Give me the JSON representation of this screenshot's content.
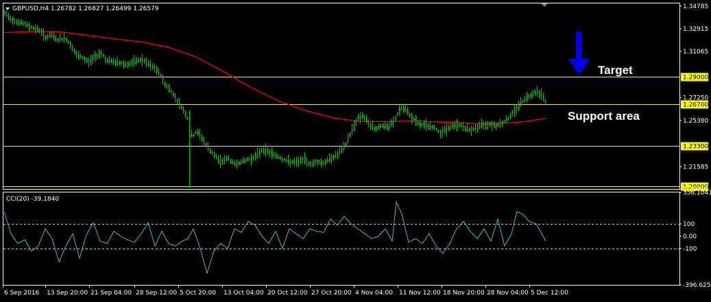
{
  "header": {
    "symbol_line": "GBPUSD,H4  1.26782 1.26827 1.26499 1.26579",
    "menu_icon": "triangle-down-icon"
  },
  "annotations": {
    "target_label": "Target",
    "support_label": "Support area",
    "arrow_icon": "arrow-down-icon",
    "arrow_color": "#0000ff"
  },
  "colors": {
    "background": "#000000",
    "candles": "#00c800",
    "moving_average": "#ff0000",
    "levels": "#e6e680",
    "level_badge": "#ffff00",
    "cci": "#34c2c2",
    "axis": "#ffffff"
  },
  "chart_data": [
    {
      "type": "line",
      "title": "GBPUSD,H4",
      "ylim": [
        1.1975,
        1.35
      ],
      "price_ticks": [
        "1.34785",
        "1.32915",
        "1.31065",
        "1.27250",
        "1.25380",
        "1.21585",
        "1.19715"
      ],
      "level_lines": [
        {
          "value": 1.29,
          "label": "1.29000"
        },
        {
          "value": 1.267,
          "label": "1.26700"
        },
        {
          "value": 1.233,
          "label": "1.23300"
        },
        {
          "value": 1.2,
          "label": "1.20000"
        }
      ],
      "x_tick_labels": [
        "6 Sep 2016",
        "13 Sep 20:00",
        "21 Sep 04:00",
        "28 Sep 12:00",
        "5 Oct 20:00",
        "13 Oct 04:00",
        "20 Oct 12:00",
        "27 Oct 20:00",
        "4 Nov 04:00",
        "11 Nov 12:00",
        "18 Nov 20:00",
        "28 Nov 04:00",
        "5 Dec 12:00"
      ],
      "series": [
        {
          "name": "Price",
          "x": [
            0,
            8,
            18,
            30,
            42,
            52,
            60,
            68,
            78,
            88,
            98,
            104,
            112,
            122,
            130,
            140,
            150,
            160,
            170,
            180,
            190,
            200,
            210,
            218,
            226,
            234,
            242,
            250,
            258,
            266,
            270,
            274,
            280,
            288,
            296,
            306,
            316,
            326,
            336,
            346,
            356,
            366,
            376,
            386,
            396,
            406,
            416,
            426,
            436,
            446,
            456,
            466,
            476,
            486,
            496,
            506,
            514,
            522,
            530,
            540,
            550,
            560,
            570,
            578,
            586,
            596,
            606,
            616,
            626,
            636,
            646,
            656,
            666,
            676,
            686,
            696,
            706,
            716,
            726,
            736,
            744,
            752,
            760,
            768,
            776,
            784,
            790
          ],
          "values": [
            1.342,
            1.338,
            1.335,
            1.333,
            1.33,
            1.328,
            1.322,
            1.324,
            1.32,
            1.322,
            1.315,
            1.308,
            1.306,
            1.302,
            1.305,
            1.31,
            1.303,
            1.302,
            1.301,
            1.3,
            1.302,
            1.304,
            1.3,
            1.297,
            1.293,
            1.284,
            1.279,
            1.272,
            1.265,
            1.258,
            1.248,
            1.24,
            1.245,
            1.24,
            1.232,
            1.225,
            1.22,
            1.223,
            1.218,
            1.22,
            1.222,
            1.224,
            1.23,
            1.228,
            1.225,
            1.222,
            1.22,
            1.219,
            1.222,
            1.218,
            1.22,
            1.219,
            1.223,
            1.226,
            1.232,
            1.245,
            1.255,
            1.258,
            1.252,
            1.247,
            1.25,
            1.248,
            1.255,
            1.265,
            1.262,
            1.255,
            1.25,
            1.25,
            1.248,
            1.244,
            1.247,
            1.25,
            1.25,
            1.246,
            1.247,
            1.25,
            1.251,
            1.25,
            1.252,
            1.256,
            1.262,
            1.268,
            1.272,
            1.275,
            1.278,
            1.276,
            1.268
          ]
        },
        {
          "name": "MA",
          "x": [
            0,
            40,
            80,
            120,
            160,
            200,
            240,
            280,
            320,
            360,
            400,
            440,
            480,
            520,
            560,
            600,
            640,
            680,
            720,
            760,
            790
          ],
          "values": [
            1.326,
            1.327,
            1.3268,
            1.324,
            1.321,
            1.3185,
            1.314,
            1.306,
            1.294,
            1.281,
            1.27,
            1.262,
            1.256,
            1.253,
            1.253,
            1.2535,
            1.2525,
            1.2515,
            1.251,
            1.253,
            1.2555
          ]
        }
      ]
    },
    {
      "type": "line",
      "title": "CCI(20) -39.1840",
      "ylim": [
        -396.6259,
        356.1041
      ],
      "tick_labels": [
        "356.1041",
        "100",
        "0.00",
        "-100",
        "-396.6259"
      ],
      "reference_lines": [
        100,
        -100
      ],
      "series": [
        {
          "name": "CCI(20)",
          "x": [
            0,
            10,
            20,
            30,
            40,
            50,
            60,
            70,
            80,
            90,
            100,
            110,
            120,
            130,
            140,
            150,
            160,
            170,
            180,
            190,
            200,
            210,
            220,
            230,
            240,
            250,
            260,
            268,
            276,
            286,
            296,
            306,
            316,
            326,
            336,
            346,
            356,
            366,
            376,
            386,
            396,
            406,
            416,
            426,
            436,
            446,
            456,
            466,
            476,
            486,
            496,
            506,
            516,
            526,
            536,
            546,
            556,
            566,
            572,
            580,
            590,
            600,
            610,
            620,
            630,
            640,
            650,
            660,
            670,
            680,
            690,
            700,
            710,
            720,
            730,
            740,
            748,
            756,
            766,
            776,
            786,
            790
          ],
          "values": [
            200,
            20,
            -60,
            -30,
            -120,
            -80,
            60,
            -20,
            -210,
            -80,
            20,
            -180,
            10,
            110,
            -40,
            -60,
            40,
            0,
            -30,
            -50,
            20,
            110,
            -80,
            40,
            -60,
            -80,
            -40,
            -20,
            60,
            -100,
            -300,
            -120,
            -60,
            -100,
            60,
            30,
            120,
            90,
            0,
            -60,
            40,
            -100,
            60,
            20,
            -20,
            60,
            40,
            30,
            140,
            90,
            160,
            100,
            60,
            20,
            -20,
            0,
            60,
            -40,
            280,
            180,
            -50,
            -20,
            -60,
            20,
            -80,
            -140,
            -60,
            60,
            120,
            40,
            -20,
            60,
            -40,
            140,
            -80,
            20,
            200,
            180,
            120,
            100,
            0,
            -40
          ]
        }
      ]
    }
  ]
}
